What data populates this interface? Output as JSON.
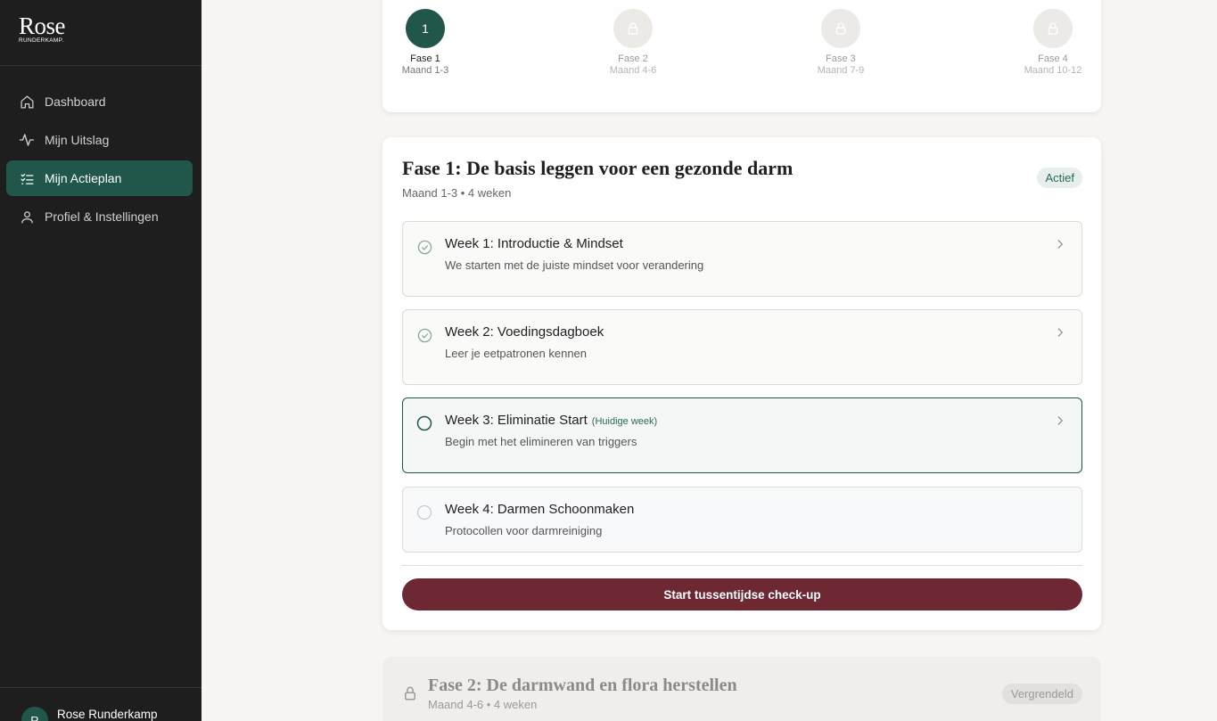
{
  "brand": {
    "name": "Rose",
    "sub": "RUNDERKAMP."
  },
  "nav": [
    {
      "label": "Dashboard",
      "icon": "home-icon"
    },
    {
      "label": "Mijn Uitslag",
      "icon": "activity-icon"
    },
    {
      "label": "Mijn Actieplan",
      "icon": "checklist-icon",
      "active": true
    },
    {
      "label": "Profiel & Instellingen",
      "icon": "user-icon"
    }
  ],
  "user": {
    "initial": "R",
    "name": "Rose Runderkamp"
  },
  "steps": [
    {
      "number": "1",
      "label": "Fase 1",
      "sub": "Maand 1-3",
      "state": "active"
    },
    {
      "label": "Fase 2",
      "sub": "Maand 4-6",
      "state": "locked"
    },
    {
      "label": "Fase 3",
      "sub": "Maand 7-9",
      "state": "locked"
    },
    {
      "label": "Fase 4",
      "sub": "Maand 10-12",
      "state": "locked"
    }
  ],
  "phase1": {
    "title": "Fase 1: De basis leggen voor een gezonde darm",
    "sub": "Maand 1-3 • 4 weken",
    "badge": "Actief",
    "weeks": [
      {
        "title": "Week 1: Introductie & Mindset",
        "desc": "We starten met de juiste mindset voor verandering",
        "status": "done"
      },
      {
        "title": "Week 2: Voedingsdagboek",
        "desc": "Leer je eetpatronen kennen",
        "status": "done"
      },
      {
        "title": "Week 3: Eliminatie Start",
        "tag": "(Huidige week)",
        "desc": "Begin met het elimineren van triggers",
        "status": "current"
      },
      {
        "title": "Week 4: Darmen Schoonmaken",
        "desc": "Protocollen voor darmreiniging",
        "status": "upcoming"
      }
    ],
    "cta": "Start tussentijdse check-up"
  },
  "phase2": {
    "title": "Fase 2: De darmwand en flora herstellen",
    "sub": "Maand 4-6 • 4 weken",
    "badge": "Vergrendeld"
  },
  "colors": {
    "accent": "#20574a",
    "cta": "#6d2833",
    "sidebar": "#1e1e1e",
    "background": "#f7f5f1"
  }
}
